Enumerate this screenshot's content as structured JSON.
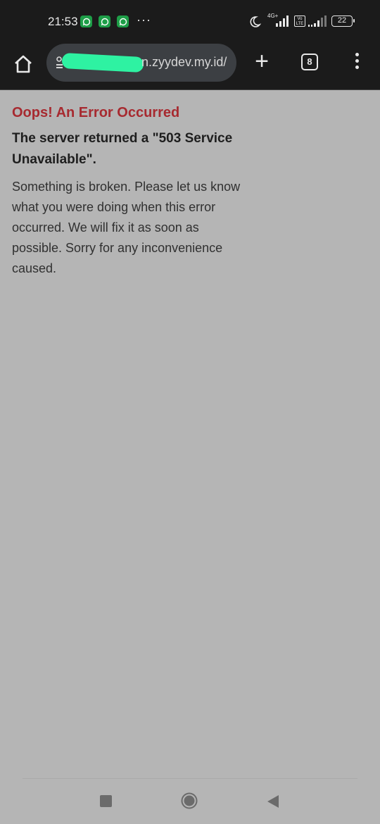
{
  "status_bar": {
    "time": "21:53",
    "notification_icons": [
      "whatsapp-icon",
      "whatsapp-icon",
      "whatsapp-icon"
    ],
    "more_indicator": "···",
    "network_type": "4G+",
    "volte_label": "Vo LTE",
    "battery_level": "22"
  },
  "browser": {
    "url_visible": "n.zyydev.my.id/",
    "url_redacted": true,
    "new_tab_label": "+",
    "tab_count": "8",
    "icons": {
      "home": "home-icon",
      "site_info": "site-info-icon",
      "menu": "more-vert-icon"
    }
  },
  "page": {
    "heading": "Oops! An Error Occurred",
    "subheading": "The server returned a \"503 Service Unavailable\".",
    "body": "Something is broken. Please let us know what you were doing when this error occurred. We will fix it as soon as possible. Sorry for any inconvenience caused."
  },
  "nav_bar": {
    "buttons": [
      "recents-icon",
      "home-icon",
      "back-icon"
    ]
  },
  "colors": {
    "page_background": "#b5b5b5",
    "chrome_background": "#1b1b1b",
    "heading": "#a72a30",
    "redaction": "#2ef2a2"
  }
}
